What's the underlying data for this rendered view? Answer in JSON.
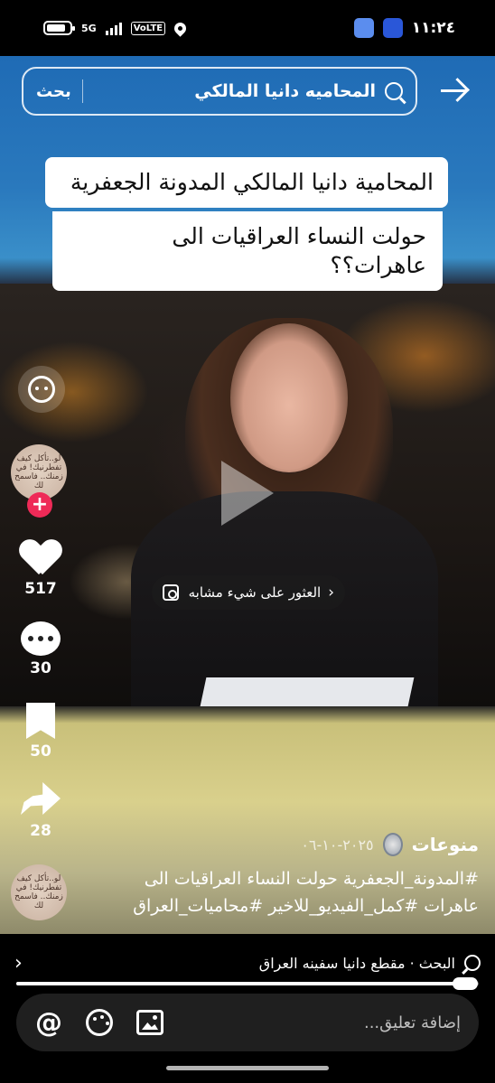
{
  "status": {
    "time": "١١:٢٤",
    "network": "5G",
    "volte": "VoLTE"
  },
  "search": {
    "query": "المحاميه دانيا المالكي",
    "button_label": "بحث"
  },
  "caption": {
    "line1": "المحامية دانيا المالكي المدونة الجعفرية",
    "line2": "حولت النساء العراقيات الى عاهرات؟؟"
  },
  "find_similar": {
    "label": "العثور على شيء مشابه"
  },
  "actions": {
    "likes": "517",
    "comments": "30",
    "saves": "50",
    "shares": "28"
  },
  "post": {
    "author": "منوعات",
    "date": "٢٠٢٥-١٠-٠٦",
    "description": "#المدونة_الجعفرية حولت النساء العراقيات الى عاهرات #كمل_الفيديو_للاخير #محاميات_العراق",
    "avatar_text": "لو..تأكل كيف تفطرنيك! في زمنك.. فاسمح لك"
  },
  "playback": {
    "progress": 0.97
  },
  "related_search": {
    "label": "البحث · مقطع دانيا سفينه العراق"
  },
  "comment_bar": {
    "placeholder": "إضافة تعليق..."
  },
  "colors": {
    "follow_accent": "#ee2a57",
    "sky_blue": "#1f6bb5"
  },
  "icons": [
    "battery-icon",
    "signal-icon",
    "location-icon",
    "search-icon",
    "back-arrow-icon",
    "play-icon",
    "emoji-icon",
    "heart-icon",
    "comment-icon",
    "bookmark-icon",
    "share-icon",
    "at-icon",
    "palette-icon",
    "image-icon"
  ]
}
